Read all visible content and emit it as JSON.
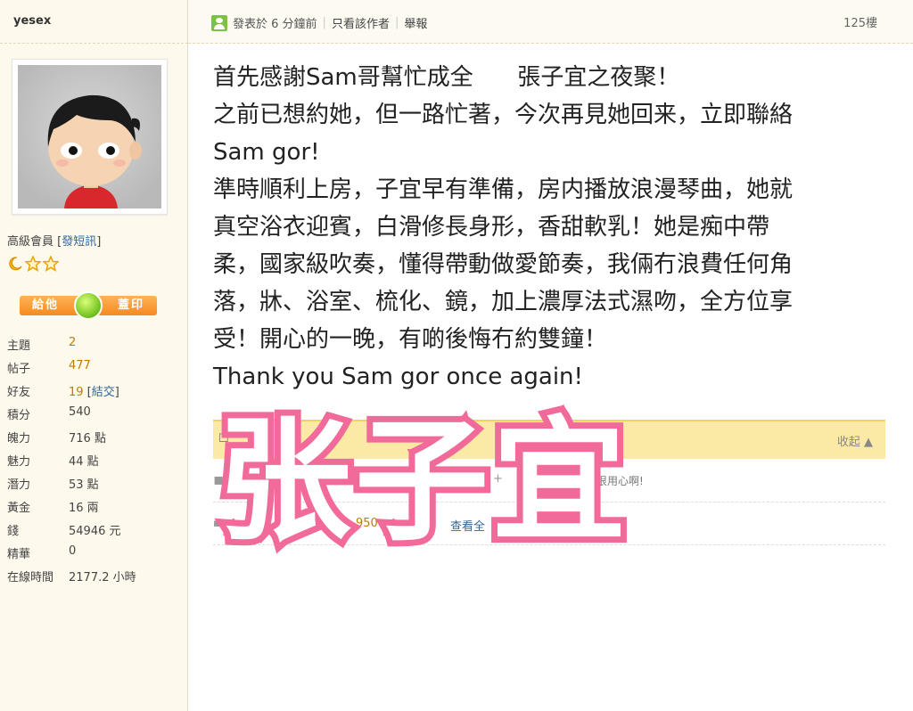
{
  "sidebar": {
    "username": "yesex",
    "member_level": "高級會員",
    "send_message_link": "發短訊",
    "buttons": {
      "give": "給他",
      "cover": "蓋印"
    },
    "stats": [
      {
        "label": "主題",
        "value": "2",
        "link": ""
      },
      {
        "label": "帖子",
        "value": "477",
        "link": ""
      },
      {
        "label": "好友",
        "value": "19",
        "link": "結交"
      },
      {
        "label": "積分",
        "value": "540",
        "link": ""
      },
      {
        "label": "魄力",
        "value": "716 點",
        "link": ""
      },
      {
        "label": "魅力",
        "value": "44 點",
        "link": ""
      },
      {
        "label": "潛力",
        "value": "53 點",
        "link": ""
      },
      {
        "label": "黃金",
        "value": "16 兩",
        "link": ""
      },
      {
        "label": "錢",
        "value": "54946 元",
        "link": ""
      },
      {
        "label": "精華",
        "value": "0",
        "link": ""
      },
      {
        "label": "在線時間",
        "value": "2177.2 小時",
        "link": ""
      }
    ]
  },
  "header": {
    "posted_at": "發表於 6 分鐘前",
    "only_author": "只看該作者",
    "report": "舉報",
    "floor": "125樓"
  },
  "post": {
    "lines": [
      "首先感謝Sam哥幫忙成全      張子宜之夜聚！",
      "之前已想約她，但一路忙著，今次再見她回来，立即聯絡",
      "Sam gor!",
      "準時順利上房，子宜早有準備，房内播放浪漫琴曲，她就",
      "真空浴衣迎賓，白滑修長身形，香甜軟乳！她是痴中帶",
      "柔，國家級吹奏，懂得帶動做愛節奏，我倆冇浪費任何角",
      "落，牀、浴室、梳化、鏡，加上濃厚法式濕吻，全方位享",
      "受！開心的一晚，有啲後悔冇約雙鐘！",
      "Thank you Sam gor once again!"
    ]
  },
  "comments": {
    "collapse": "收起",
    "comment_excerpt": "很用心啊!",
    "stats_partial": "950",
    "view_link": "查看全"
  },
  "watermark": "张子宜",
  "colors": {
    "sidebar_bg": "#fdf9ec",
    "accent_orange": "#f58a1f",
    "rate_bar": "#fbe9a6",
    "watermark_stroke": "#f26a9a"
  }
}
